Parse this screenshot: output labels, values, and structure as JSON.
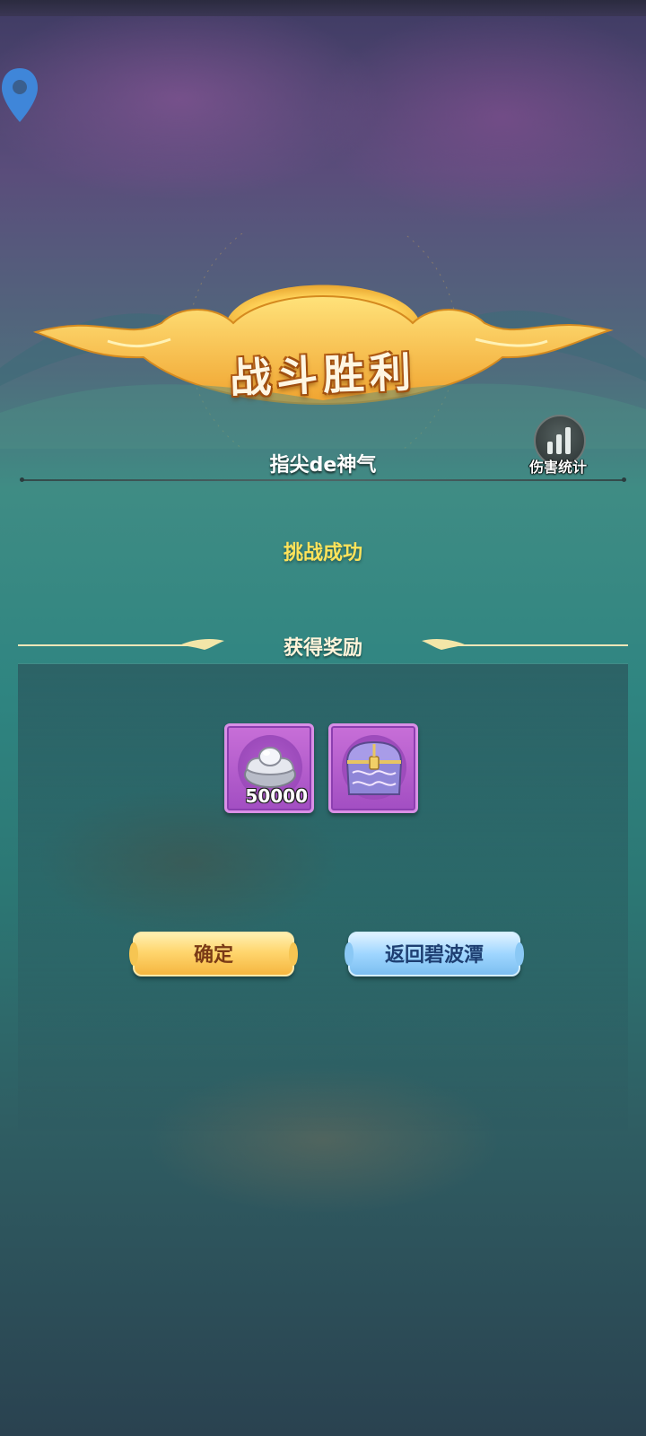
{
  "banner": {
    "title": "战斗胜利"
  },
  "player": {
    "name": "指尖de神气"
  },
  "damage_stats": {
    "label": "伤害统计",
    "icon": "bar-chart-icon"
  },
  "challenge": {
    "status": "挑战成功"
  },
  "rewards": {
    "title": "获得奖励",
    "items": [
      {
        "icon": "silver-ingot-icon",
        "count": "50000"
      },
      {
        "icon": "treasure-chest-icon",
        "count": ""
      }
    ]
  },
  "buttons": {
    "confirm": "确定",
    "return": "返回碧波潭"
  },
  "colors": {
    "victory_gold": "#ffd66e",
    "status_yellow": "#ffe35a",
    "item_purple": "#b15ccb",
    "return_blue": "#9fd6ff"
  }
}
